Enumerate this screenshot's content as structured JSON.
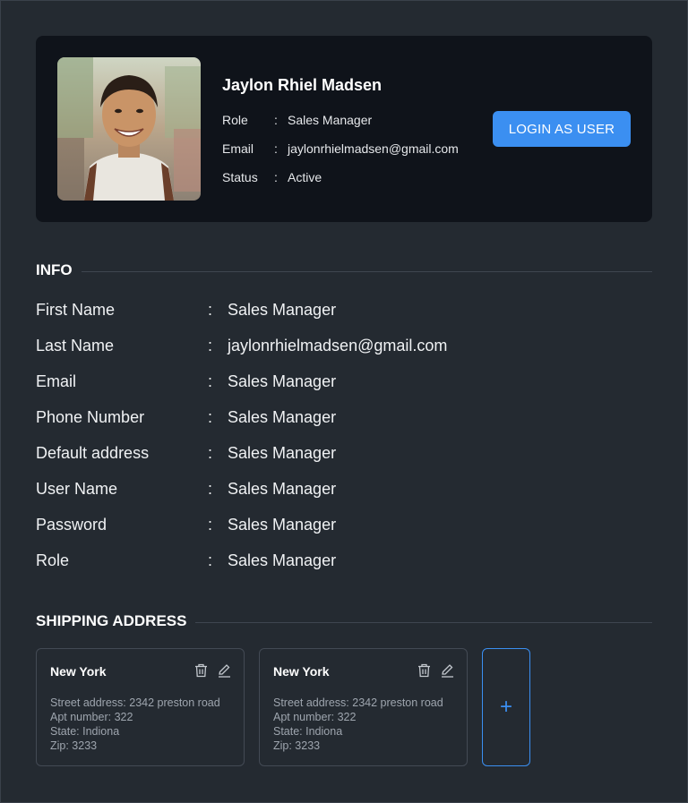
{
  "profile": {
    "name": "Jaylon Rhiel Madsen",
    "fields": [
      {
        "label": "Role",
        "value": "Sales Manager"
      },
      {
        "label": "Email",
        "value": "jaylonrhielmadsen@gmail.com"
      },
      {
        "label": "Status",
        "value": "Active"
      }
    ],
    "login_button": "LOGIN AS USER"
  },
  "info": {
    "title": "INFO",
    "rows": [
      {
        "label": "First Name",
        "value": "Sales Manager"
      },
      {
        "label": "Last Name",
        "value": "jaylonrhielmadsen@gmail.com"
      },
      {
        "label": "Email",
        "value": "Sales Manager"
      },
      {
        "label": "Phone Number",
        "value": "Sales Manager"
      },
      {
        "label": "Default address",
        "value": "Sales Manager"
      },
      {
        "label": "User Name",
        "value": "Sales Manager"
      },
      {
        "label": "Password",
        "value": "Sales Manager"
      },
      {
        "label": "Role",
        "value": "Sales Manager"
      }
    ]
  },
  "shipping": {
    "title": "SHIPPING ADDRESS",
    "addresses": [
      {
        "city": "New York",
        "street": "Street address: 2342 preston road",
        "apt": "Apt number: 322",
        "state": "State: Indiona",
        "zip": "Zip: 3233"
      },
      {
        "city": "New York",
        "street": "Street address: 2342 preston road",
        "apt": "Apt number: 322",
        "state": "State: Indiona",
        "zip": "Zip: 3233"
      }
    ],
    "add_symbol": "+"
  },
  "colors": {
    "background": "#242a31",
    "card": "#0f131a",
    "accent": "#3b8ff1"
  }
}
